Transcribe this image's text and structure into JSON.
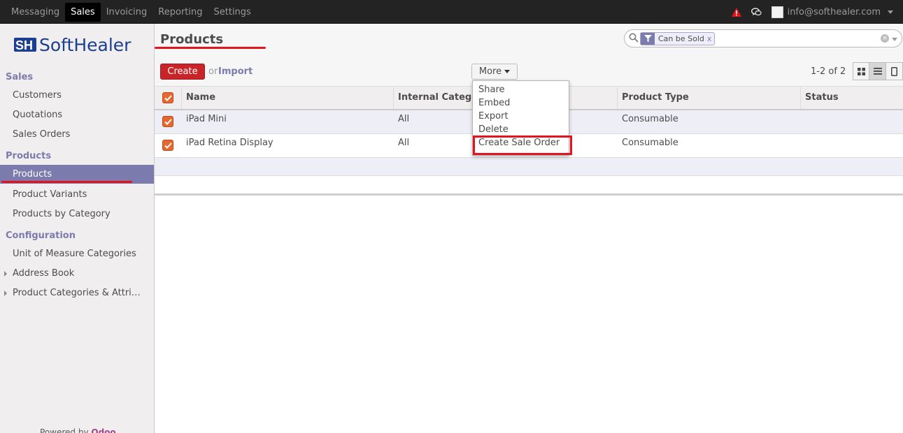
{
  "topbar": {
    "menu": [
      {
        "label": "Messaging",
        "active": false
      },
      {
        "label": "Sales",
        "active": true
      },
      {
        "label": "Invoicing",
        "active": false
      },
      {
        "label": "Reporting",
        "active": false
      },
      {
        "label": "Settings",
        "active": false
      }
    ],
    "user_email": "info@softhealer.com",
    "warning_color": "#e3141c"
  },
  "sidebar": {
    "logo_text": "SoftHealer",
    "sections": [
      {
        "title": "Sales",
        "items": [
          {
            "label": "Customers"
          },
          {
            "label": "Quotations"
          },
          {
            "label": "Sales Orders"
          }
        ]
      },
      {
        "title": "Products",
        "items": [
          {
            "label": "Products",
            "active": true
          },
          {
            "label": "Product Variants"
          },
          {
            "label": "Products by Category"
          }
        ]
      },
      {
        "title": "Configuration",
        "items": [
          {
            "label": "Unit of Measure Categories"
          },
          {
            "label": "Address Book",
            "expandable": true
          },
          {
            "label": "Product Categories & Attri…",
            "expandable": true
          }
        ]
      }
    ],
    "powered_by": "Powered by",
    "powered_brand": "Odoo",
    "accent_color": "#7c7bad"
  },
  "header": {
    "title": "Products",
    "search": {
      "facet_label": "Can be Sold",
      "facet_remove": "x"
    },
    "create_label": "Create",
    "or_label": "or",
    "import_label": "Import",
    "more_label": "More",
    "pager": "1-2 of 2"
  },
  "more_menu": {
    "items": [
      "Share",
      "Embed",
      "Export",
      "Delete",
      "Create Sale Order"
    ],
    "highlighted": "Create Sale Order"
  },
  "table": {
    "columns": [
      "Name",
      "Internal Category",
      "Product Type",
      "Status"
    ],
    "rows": [
      {
        "name": "iPad Mini",
        "internal_category": "All",
        "product_type": "Consumable",
        "status": "",
        "selected": true
      },
      {
        "name": "iPad Retina Display",
        "internal_category": "All",
        "product_type": "Consumable",
        "status": "",
        "selected": true
      }
    ]
  }
}
